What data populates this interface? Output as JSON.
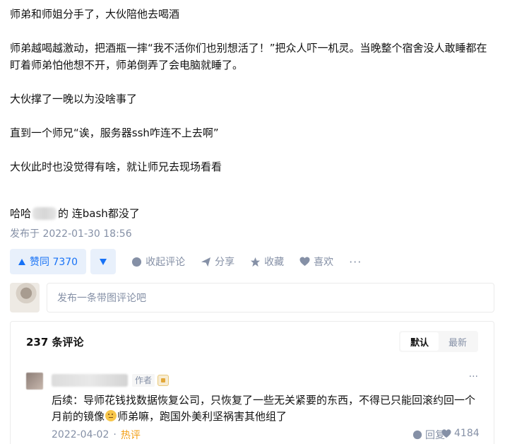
{
  "article": {
    "paragraphs": [
      "师弟和师姐分手了，大伙陪他去喝酒",
      "师弟越喝越激动，把酒瓶一摔“我不活你们也别想活了！”把众人吓一机灵。当晚整个宿舍没人敢睡都在盯着师弟怕他想不开，师弟倒弄了会电脑就睡了。",
      "大伙撑了一晚以为没啥事了",
      "直到一个师兄“诶，服务器ssh咋连不上去啊”",
      "大伙此时也没觉得有啥，就让师兄去现场看看"
    ],
    "last_line": {
      "prefix": "哈哈",
      "suffix": "的 连bash都没了"
    },
    "published": "发布于 2022-01-30 18:56"
  },
  "actions": {
    "upvote_label": "赞同 7370",
    "comment_label": "收起评论",
    "share_label": "分享",
    "favorite_label": "收藏",
    "like_label": "喜欢",
    "more_label": "···"
  },
  "comment_box": {
    "placeholder": "发布一条带图评论吧"
  },
  "comments": {
    "count_label": "237 条评论",
    "sort": {
      "default": "默认",
      "latest": "最新"
    },
    "items": [
      {
        "author_tag": "作者",
        "text_before_emoji": "后续：导师花钱找数据恢复公司，只恢复了一些无关紧要的东西，不得已只能回滚约回一个月前的镜像",
        "text_after_emoji": "师弟嘛，跑国外美利坚祸害其他组了",
        "date": "2022-04-02",
        "hot_label": "热评",
        "reply_label": "回复",
        "likes": "4184"
      }
    ]
  },
  "colors": {
    "accent": "#1772f6",
    "muted": "#8590a6",
    "hot": "#f2a017"
  }
}
